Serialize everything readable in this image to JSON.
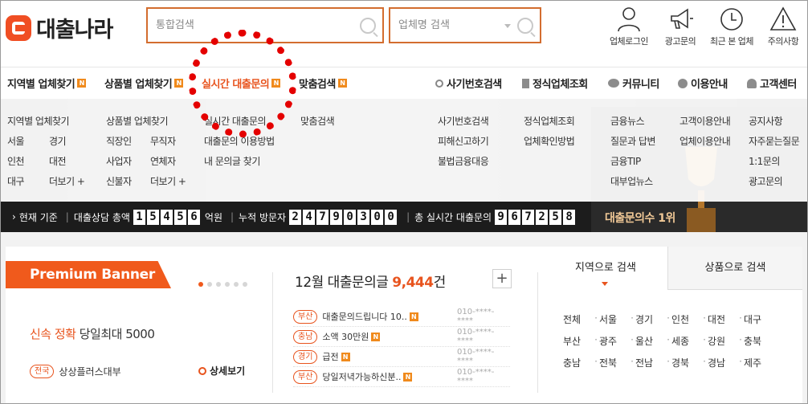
{
  "logo": {
    "text": "대출나라"
  },
  "search": {
    "main_placeholder": "통합검색",
    "corp_placeholder": "업체명 검색"
  },
  "header_icons": [
    {
      "label": "업체로그인",
      "icon": "user-icon"
    },
    {
      "label": "광고문의",
      "icon": "megaphone-icon"
    },
    {
      "label": "최근 본 업체",
      "icon": "clock-icon"
    },
    {
      "label": "주의사항",
      "icon": "warning-icon"
    }
  ],
  "nav": {
    "items": [
      {
        "label": "지역별 업체찾기",
        "badge": "N"
      },
      {
        "label": "상품별 업체찾기",
        "badge": "N"
      },
      {
        "label": "실시간 대출문의",
        "badge": "N"
      },
      {
        "label": "맞춤검색",
        "badge": "N"
      },
      {
        "label": "사기번호검색"
      },
      {
        "label": "정식업체조회"
      },
      {
        "label": "커뮤니티"
      },
      {
        "label": "이용안내"
      },
      {
        "label": "고객센터"
      }
    ]
  },
  "dropdown": {
    "region": {
      "title": "지역별 업체찾기",
      "cities": [
        "서울",
        "경기",
        "인천",
        "대전",
        "대구",
        "더보기 +"
      ]
    },
    "product": {
      "title": "상품별 업체찾기",
      "types": [
        "직장인",
        "무직자",
        "사업자",
        "연체자",
        "신불자",
        "더보기 +"
      ]
    },
    "realtime": [
      "실시간 대출문의",
      "대출문의 이용방법",
      "내 문의글 찾기"
    ],
    "custom": [
      "맞춤검색"
    ],
    "fraud": [
      "사기번호검색",
      "피해신고하기",
      "불법금융대응"
    ],
    "official": [
      "정식업체조회",
      "업체확인방법"
    ],
    "community": [
      "금융뉴스",
      "질문과 답변",
      "금융TIP",
      "대부업뉴스"
    ],
    "guide": [
      "고객이용안내",
      "업체이용안내"
    ],
    "support": [
      "공지사항",
      "자주묻는질문",
      "1:1문의",
      "광고문의"
    ]
  },
  "ticker": {
    "label_now": "현재 기준",
    "label_total": "대출상담 총액",
    "total_digits": [
      "1",
      "5",
      "4",
      "5",
      "6"
    ],
    "unit_total": "억원",
    "label_visitors": "누적 방문자",
    "visitor_digits": [
      "2",
      "4",
      "7",
      "9",
      "0",
      "3",
      "0",
      "0"
    ],
    "label_realtime": "총 실시간 대출문의",
    "realtime_digits": [
      "9",
      "6",
      "7",
      "2",
      "5",
      "8"
    ]
  },
  "trophy": {
    "text": "대출문의수 1위"
  },
  "premium": {
    "tag": "Premium Banner",
    "title_hl": "신속 정확",
    "title_rest": " 당일최대 5000",
    "region_tag": "전국",
    "company": "상상플러스대부",
    "detail": "상세보기"
  },
  "inquiry": {
    "title_prefix": "12월 대출문의글 ",
    "count": "9,444",
    "title_suffix": "건",
    "plus": "+",
    "rows": [
      {
        "region": "부산",
        "text": "대출문의드립니다 10..",
        "badge": "N",
        "phone": "010-****-****"
      },
      {
        "region": "충남",
        "text": "소액 30만원",
        "badge": "N",
        "phone": "010-****-****"
      },
      {
        "region": "경기",
        "text": "급전",
        "badge": "N",
        "phone": "010-****-****"
      },
      {
        "region": "부산",
        "text": "당일저녁가능하신분..",
        "badge": "N",
        "phone": "010-****-****"
      }
    ]
  },
  "tabs": {
    "region": "지역으로 검색",
    "product": "상품으로 검색"
  },
  "regions": [
    "전체",
    "서울",
    "경기",
    "인천",
    "대전",
    "대구",
    "부산",
    "광주",
    "울산",
    "세종",
    "강원",
    "충북",
    "충남",
    "전북",
    "전남",
    "경북",
    "경남",
    "제주"
  ],
  "colors": {
    "brand": "#f05a1c",
    "nav_active": "#e8541e",
    "badge": "#f08a1c",
    "highlight_ring": "#e40000"
  }
}
